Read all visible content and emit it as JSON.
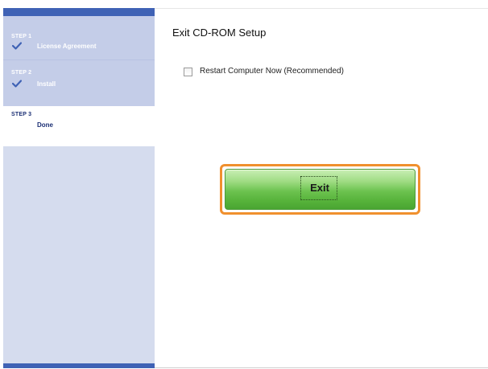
{
  "window": {
    "title": "Exit CD-ROM Setup"
  },
  "sidebar": {
    "steps": [
      {
        "step_label": "STEP 1",
        "name": "License Agreement",
        "state": "completed",
        "icon": "check-icon"
      },
      {
        "step_label": "STEP 2",
        "name": "Install",
        "state": "completed",
        "icon": "check-icon"
      },
      {
        "step_label": "STEP 3",
        "name": "Done",
        "state": "current",
        "icon": ""
      }
    ]
  },
  "main": {
    "restart_checkbox": {
      "label": "Restart Computer Now (Recommended)",
      "checked": false
    },
    "exit_button": {
      "label": "Exit"
    }
  },
  "colors": {
    "sidebar_bg": "#d5dcee",
    "sidebar_accent": "#3f62b5",
    "highlight": "#f0902e",
    "button_green": "#6cc24f"
  }
}
